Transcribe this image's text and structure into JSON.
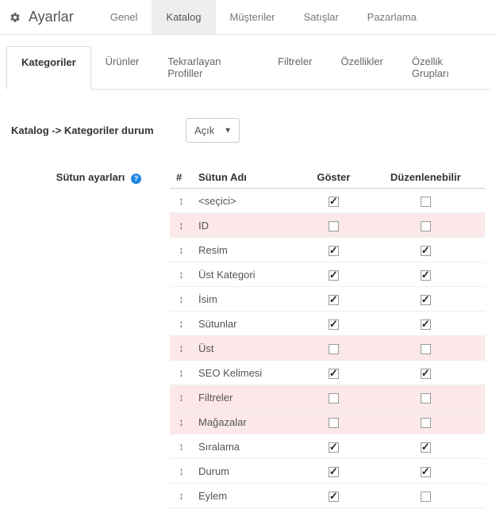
{
  "header": {
    "title": "Ayarlar",
    "tabs": [
      {
        "label": "Genel",
        "active": false
      },
      {
        "label": "Katalog",
        "active": true
      },
      {
        "label": "Müşteriler",
        "active": false
      },
      {
        "label": "Satışlar",
        "active": false
      },
      {
        "label": "Pazarlama",
        "active": false
      }
    ]
  },
  "subtabs": [
    {
      "label": "Kategoriler",
      "active": true
    },
    {
      "label": "Ürünler",
      "active": false
    },
    {
      "label": "Tekrarlayan Profiller",
      "active": false
    },
    {
      "label": "Filtreler",
      "active": false
    },
    {
      "label": "Özellikler",
      "active": false
    },
    {
      "label": "Özellik Grupları",
      "active": false
    }
  ],
  "status": {
    "label": "Katalog -> Kategoriler durum",
    "value": "Açık"
  },
  "columns": {
    "label": "Sütun ayarları",
    "headers": {
      "handle": "#",
      "name": "Sütun Adı",
      "show": "Göster",
      "editable": "Düzenlenebilir"
    },
    "rows": [
      {
        "name": "<seçici>",
        "show": true,
        "editable": false,
        "pink": false
      },
      {
        "name": "ID",
        "show": false,
        "editable": false,
        "pink": true
      },
      {
        "name": "Resim",
        "show": true,
        "editable": true,
        "pink": false
      },
      {
        "name": "Üst Kategori",
        "show": true,
        "editable": true,
        "pink": false
      },
      {
        "name": "İsim",
        "show": true,
        "editable": true,
        "pink": false
      },
      {
        "name": "Sütunlar",
        "show": true,
        "editable": true,
        "pink": false
      },
      {
        "name": "Üst",
        "show": false,
        "editable": false,
        "pink": true
      },
      {
        "name": "SEO Kelimesi",
        "show": true,
        "editable": true,
        "pink": false
      },
      {
        "name": "Filtreler",
        "show": false,
        "editable": false,
        "pink": true
      },
      {
        "name": "Mağazalar",
        "show": false,
        "editable": false,
        "pink": true
      },
      {
        "name": "Sıralama",
        "show": true,
        "editable": true,
        "pink": false
      },
      {
        "name": "Durum",
        "show": true,
        "editable": true,
        "pink": false
      },
      {
        "name": "Eylem",
        "show": true,
        "editable": false,
        "pink": false
      }
    ]
  }
}
